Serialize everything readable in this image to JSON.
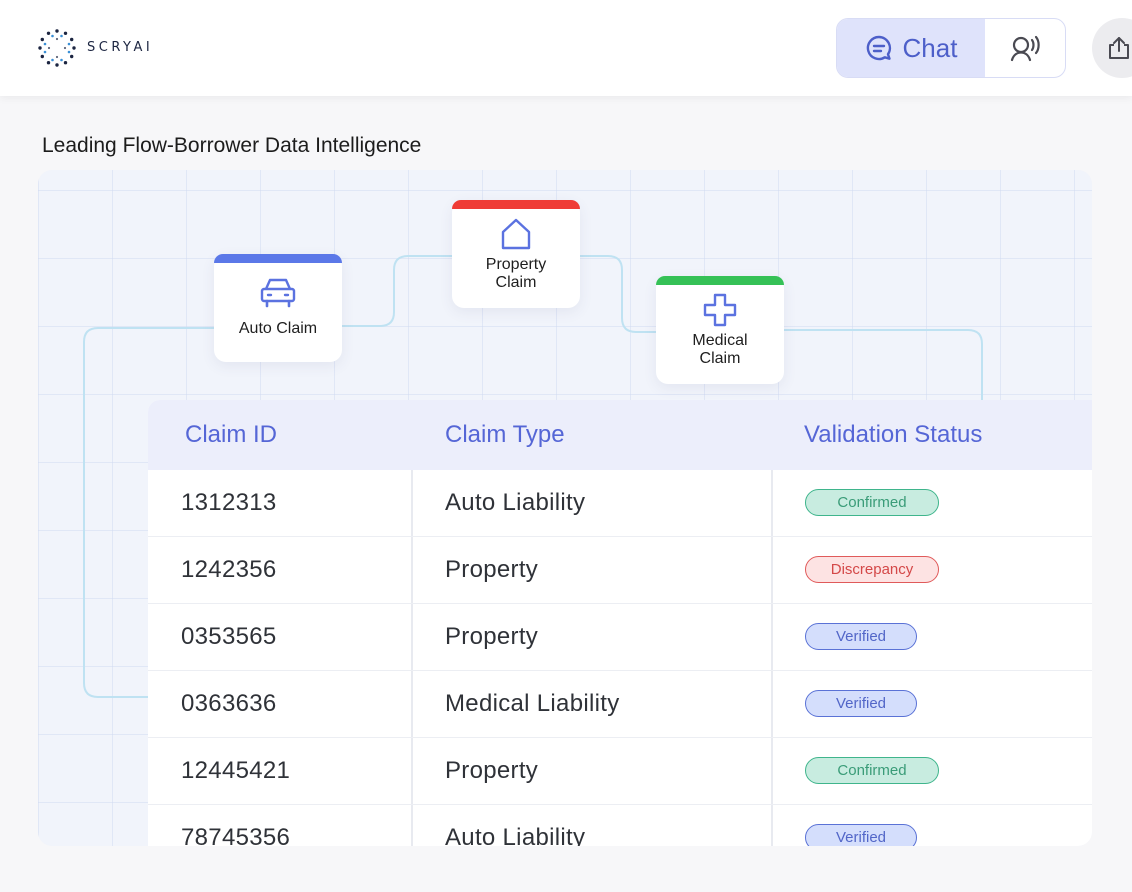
{
  "brand": {
    "name": "SCRYAI"
  },
  "header": {
    "chat_label": "Chat",
    "icons": [
      "chat-bubble-icon",
      "voice-icon",
      "share-icon"
    ]
  },
  "section": {
    "title": "Leading Flow-Borrower Data Intelligence"
  },
  "nodes": [
    {
      "label": "Auto Claim",
      "icon": "car-icon",
      "color": "#5b78e8"
    },
    {
      "label": "Property\nClaim",
      "icon": "house-icon",
      "color": "#ef3b36"
    },
    {
      "label": "Medical\nClaim",
      "icon": "medical-cross-icon",
      "color": "#35c156"
    }
  ],
  "table": {
    "headers": [
      "Claim ID",
      "Claim Type",
      "Validation Status"
    ],
    "rows": [
      {
        "id": "1312313",
        "type": "Auto Liability",
        "status": "Confirmed"
      },
      {
        "id": "1242356",
        "type": "Property",
        "status": "Discrepancy"
      },
      {
        "id": "0353565",
        "type": "Property",
        "status": "Verified"
      },
      {
        "id": "0363636",
        "type": "Medical Liability",
        "status": "Verified"
      },
      {
        "id": "12445421",
        "type": "Property",
        "status": "Confirmed"
      },
      {
        "id": "78745356",
        "type": "Auto Liability",
        "status": "Verified"
      }
    ]
  },
  "colors": {
    "accent": "#4d5fc9",
    "confirmed": "#3fb58c",
    "discrepancy": "#e05a5a",
    "verified": "#5a72d6"
  }
}
